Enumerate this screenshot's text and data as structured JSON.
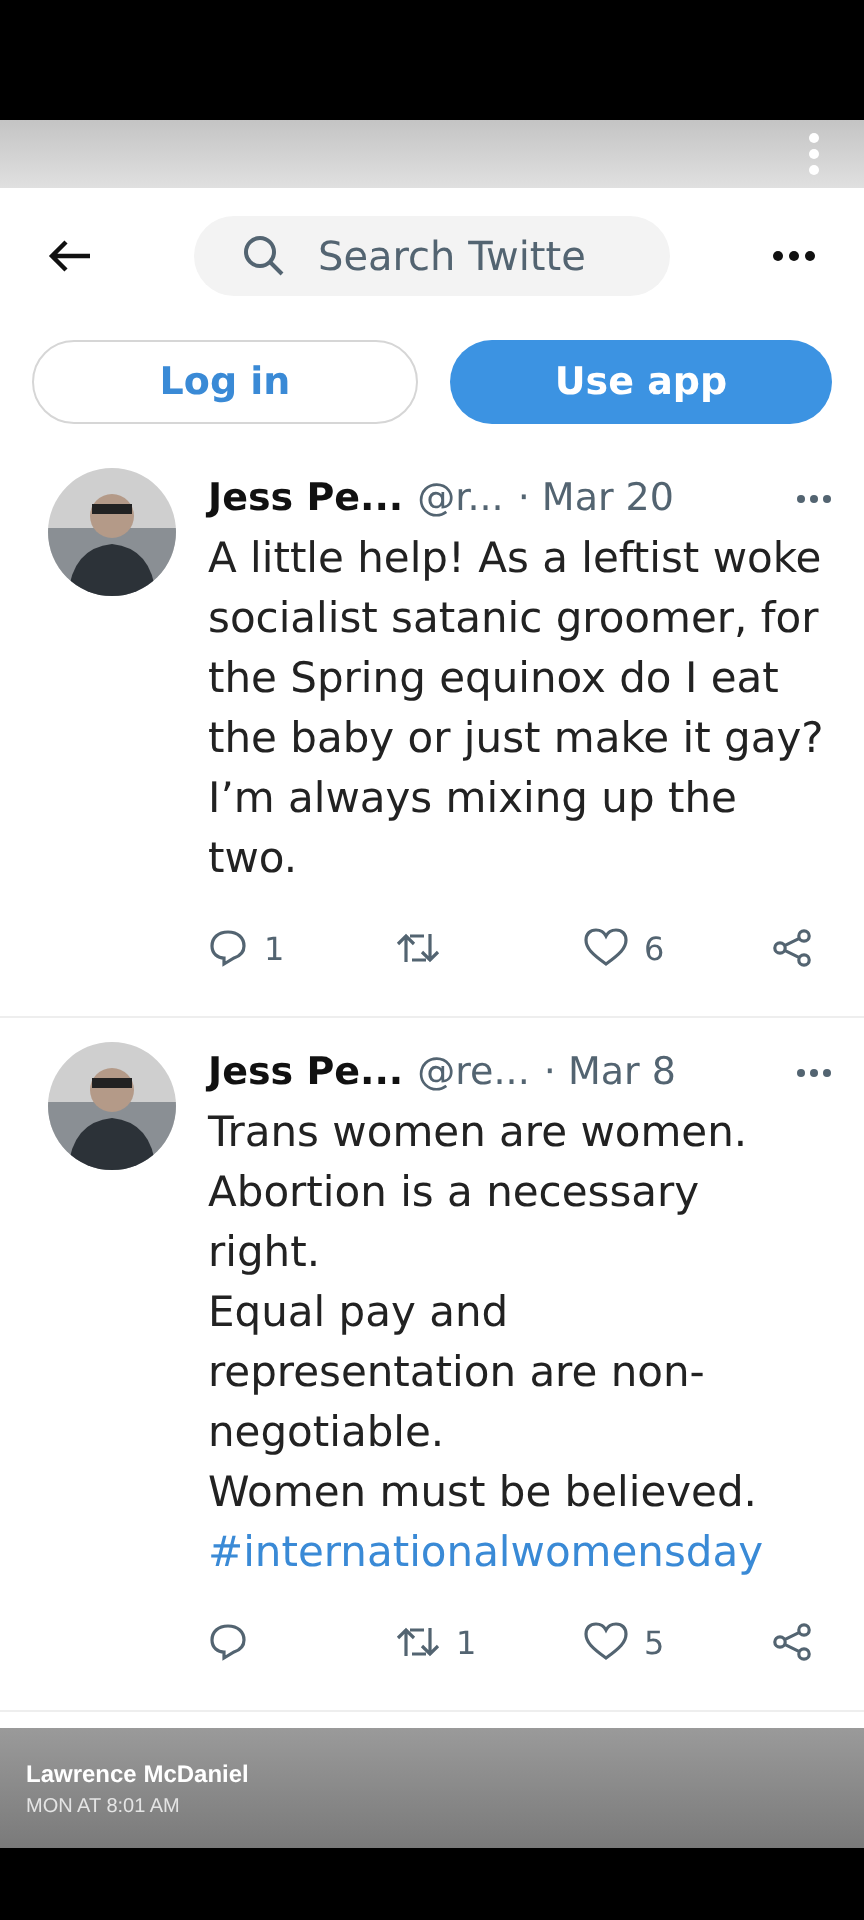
{
  "search": {
    "placeholder": "Search Twitte"
  },
  "buttons": [
    {
      "label": "Log in",
      "kind": "outline"
    },
    {
      "label": "Use app",
      "kind": "filled"
    }
  ],
  "tweets": [
    {
      "name": "Jess Pe...",
      "handle": "@r...",
      "date": "· Mar 20",
      "text": "A little help! As a leftist woke socialist satanic groomer, for the Spring equinox do I eat the baby or just make it gay? I’m always mixing up the two.",
      "replies": "1",
      "likes": "6"
    },
    {
      "name": "Jess Pe...",
      "handle": "@re...",
      "date": "· Mar 8",
      "text": "Trans women are women.\nAbortion is a necessary right.\nEqual pay and representation are non-negotiable.\nWomen must be believed.",
      "hashtag": "#internationalwomensday",
      "retweets": "1",
      "likes": "5"
    }
  ],
  "poster": {
    "name": "Lawrence McDaniel",
    "time": "MON AT 8:01 AM"
  }
}
